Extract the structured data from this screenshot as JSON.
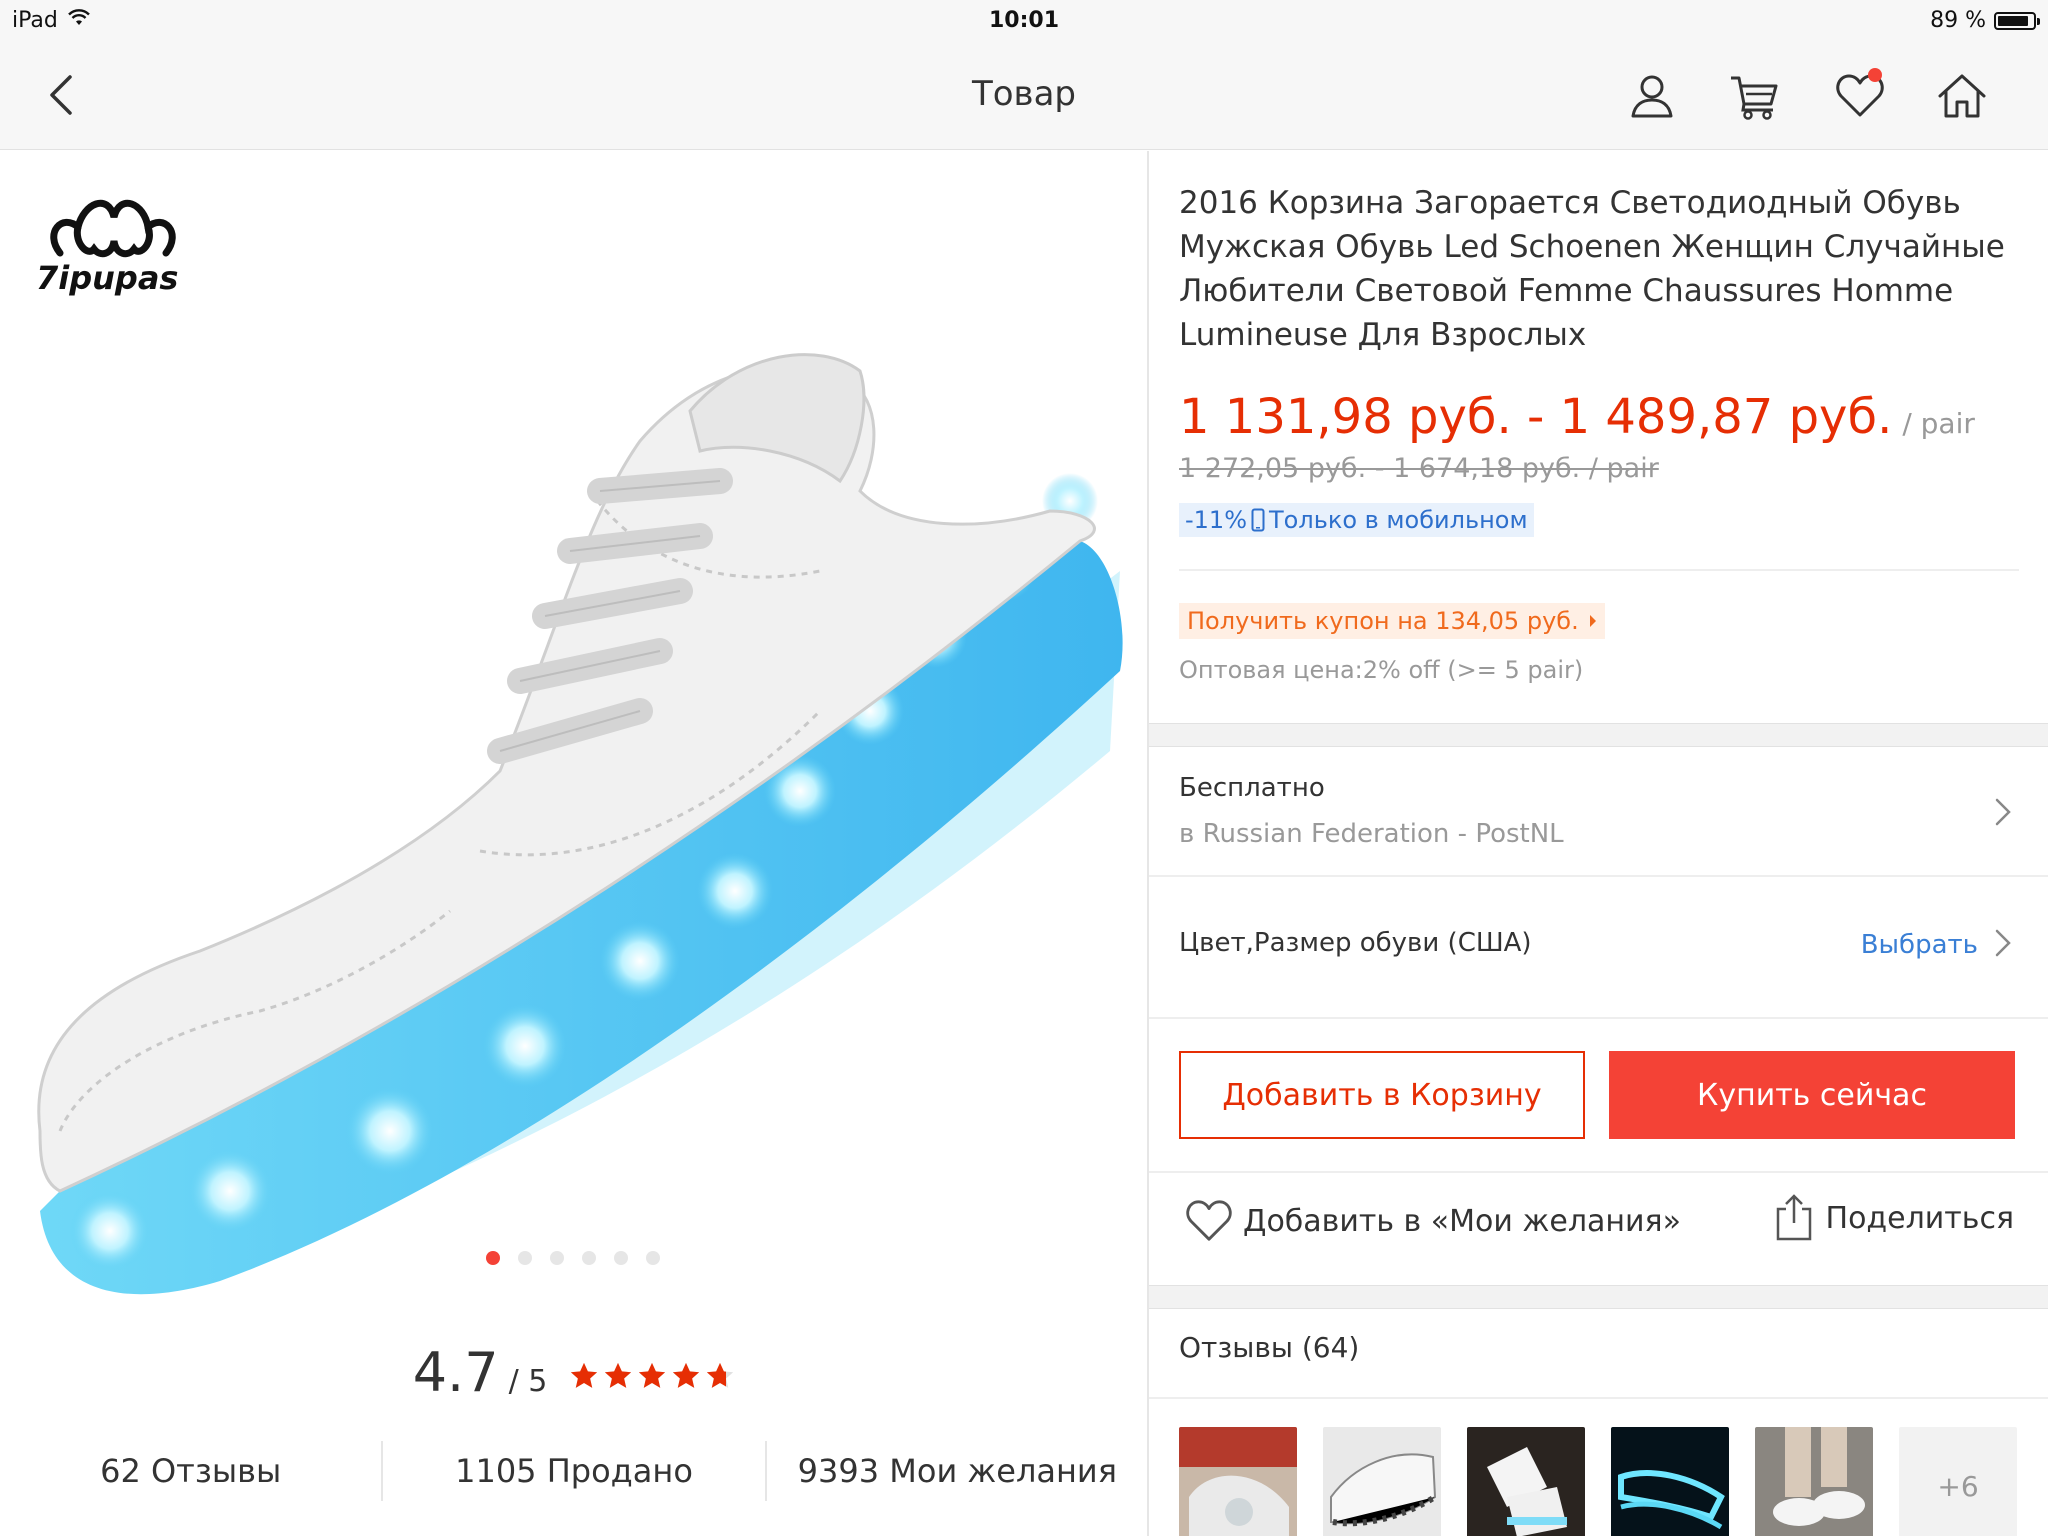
{
  "status_bar": {
    "device": "iPad",
    "time": "10:01",
    "battery": "89 %",
    "battery_level": 0.89
  },
  "nav": {
    "title": "Товар",
    "icons": [
      "back-icon",
      "account-icon",
      "cart-icon",
      "wishlist-icon",
      "home-icon"
    ]
  },
  "product": {
    "brand_logo_text": "7ipupas",
    "title": "2016 Корзина Загорается Светодиодный Обувь Мужская Обувь Led Schoenen Женщин Случайные Любители Световой Femme Chaussures Homme Lumineuse Для Взрослых",
    "price": "1 131,98 руб. - 1 489,87 руб.",
    "price_unit": "/ pair",
    "old_price": "1 272,05 руб. - 1 674,18 руб.  / pair",
    "mobile_discount": "-11%",
    "mobile_label": "Только в мобильном",
    "coupon": "Получить купон на 134,05 руб.",
    "wholesale": "Оптовая цена:2% off (>= 5 pair)",
    "gallery_count": 6,
    "gallery_active_index": 0
  },
  "rating": {
    "value": "4.7",
    "max": "/ 5",
    "score": 4.7
  },
  "stats": {
    "reviews": "62 Отзывы",
    "sold": "1105 Продано",
    "wishes": "9393 Мои желания"
  },
  "shipping": {
    "title": "Бесплатно",
    "subtitle": "в Russian Federation - PostNL"
  },
  "options": {
    "label": "Цвет,Размер обуви (США)",
    "action": "Выбрать"
  },
  "actions": {
    "add_to_cart": "Добавить в Корзину",
    "buy_now": "Купить сейчас",
    "add_wishlist": "Добавить в «Мои желания»",
    "share": "Поделиться"
  },
  "reviews": {
    "header": "Отзывы (64)",
    "more_count": "+6"
  },
  "colors": {
    "accent_red": "#f44236",
    "price_red": "#e62e04",
    "link_blue": "#3a7fd5",
    "coupon_orange": "#f06a1d"
  }
}
